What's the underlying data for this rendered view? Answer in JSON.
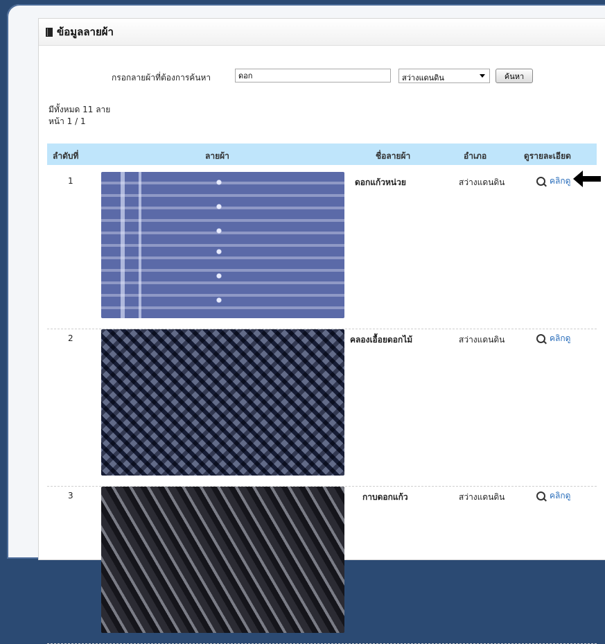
{
  "panel": {
    "title": "ข้อมูลลายผ้า"
  },
  "search": {
    "label": "กรอกลายผ้าที่ต้องการค้นหา",
    "value": "ดอก",
    "district_selected": "สว่างแดนดิน",
    "button_label": "ค้นหา"
  },
  "summary": {
    "total": "มีทั้งหมด 11 ลาย",
    "page": "หน้า 1 / 1"
  },
  "table": {
    "headers": [
      "ลำดับที่",
      "ลายผ้า",
      "ชื่อลายผ้า",
      "อำเภอ",
      "ดูรายละเอียด"
    ],
    "rows": [
      {
        "num": "1",
        "name": "ดอกแก้วหน่วย",
        "district": "สว่างแดนดิน",
        "detail": "คลิกดู",
        "pattern_color": "#5b6aa8"
      },
      {
        "num": "2",
        "name": "คลองเอื้อยดอกไม้",
        "district": "สว่างแดนดิน",
        "detail": "คลิกดู",
        "pattern_color": "#2c3552"
      },
      {
        "num": "3",
        "name": "กาบดอกแก้ว",
        "district": "สว่างแดนดิน",
        "detail": "คลิกดู",
        "pattern_color": "#2b2b33"
      }
    ]
  },
  "icons": {
    "panel": "book-icon",
    "detail": "magnifier-icon",
    "pointer": "arrow-left-icon"
  },
  "colors": {
    "header_bg": "#bfe5fb",
    "link": "#2a6ebb",
    "page_bg": "#2b4a73"
  }
}
